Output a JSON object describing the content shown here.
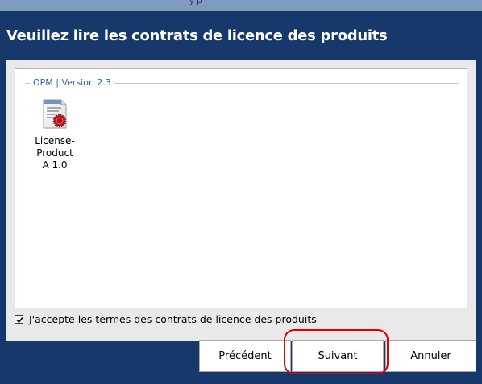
{
  "title_bar_fragment": "y   p",
  "dialog": {
    "title": "Veuillez lire les contrats de licence des produits",
    "group_label": "OPM | Version 2.3",
    "products": [
      {
        "name_line1": "License-Product",
        "name_line2": "A 1.0",
        "icon": "certificate-document-icon"
      }
    ],
    "accept_checkbox": {
      "checked": true,
      "label": "J'accepte les termes des contrats de licence des produits"
    }
  },
  "buttons": {
    "previous": "Précédent",
    "next": "Suivant",
    "cancel": "Annuler"
  },
  "colors": {
    "header_background": "#17386a",
    "group_label_text": "#2f5fae",
    "annotation_ring": "#e00000"
  }
}
